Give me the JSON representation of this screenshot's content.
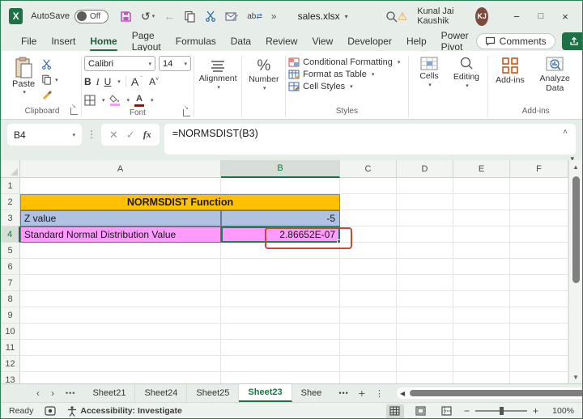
{
  "titlebar": {
    "autosave_label": "AutoSave",
    "autosave_state": "Off",
    "filename": "sales.xlsx",
    "user_name": "Kunal Jai Kaushik",
    "user_initials": "KJ",
    "logo_letter": "X"
  },
  "menu": {
    "items": [
      "File",
      "Insert",
      "Home",
      "Page Layout",
      "Formulas",
      "Data",
      "Review",
      "View",
      "Developer",
      "Help",
      "Power Pivot"
    ],
    "comments_label": "Comments"
  },
  "ribbon": {
    "clipboard_group": "Clipboard",
    "paste_label": "Paste",
    "font_group": "Font",
    "font_name": "Calibri",
    "font_size": "14",
    "bold_label": "B",
    "italic_label": "I",
    "underline_label": "U",
    "grow_font_label": "A",
    "shrink_font_label": "A",
    "font_color_label": "A",
    "alignment_label": "Alignment",
    "number_label": "Number",
    "percent_glyph": "%",
    "styles_group": "Styles",
    "conditional_formatting": "Conditional Formatting",
    "format_as_table": "Format as Table",
    "cell_styles": "Cell Styles",
    "cells_label": "Cells",
    "editing_label": "Editing",
    "addins_button": "Add-ins",
    "addins_group": "Add-ins",
    "analyze_data": "Analyze Data"
  },
  "formula_bar": {
    "cell_ref": "B4",
    "fx_label": "fx",
    "formula": "=NORMSDIST(B3)"
  },
  "grid": {
    "columns": [
      "A",
      "B",
      "C",
      "D",
      "E",
      "F"
    ],
    "rows": [
      "1",
      "2",
      "3",
      "4",
      "5",
      "6",
      "7",
      "8",
      "9",
      "10",
      "11",
      "12",
      "13"
    ],
    "title": "NORMSDIST Function",
    "z_label": "Z value",
    "z_value": "-5",
    "dist_label": "Standard Normal Distribution Value",
    "dist_value": "2.86652E-07",
    "selected_cell": "B4"
  },
  "sheet_tabs": {
    "tabs": [
      "Sheet21",
      "Sheet24",
      "Sheet25",
      "Sheet23",
      "Shee"
    ],
    "active": "Sheet23"
  },
  "status_bar": {
    "ready": "Ready",
    "accessibility": "Accessibility: Investigate",
    "zoom": "100%"
  },
  "colors": {
    "accent_green": "#1E7145",
    "header_gold": "#FFC000",
    "row_blue": "#B0C2E2",
    "row_pink": "#FF9BFE",
    "annotation_red": "#C9473D",
    "avatar_brown": "#7D4A3D",
    "save_icon_magenta": "#BF54BF"
  }
}
